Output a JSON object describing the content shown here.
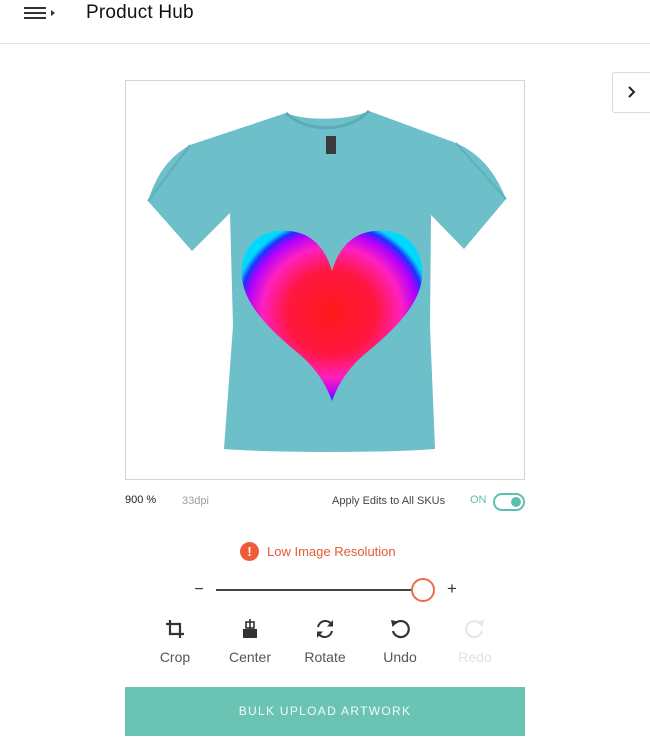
{
  "header": {
    "title": "Product Hub",
    "menu_icon": "menu-collapse-icon"
  },
  "side_toggle": {
    "icon": "chevron-right-icon"
  },
  "canvas": {
    "product": "t-shirt",
    "shirt_color": "#6dbfca",
    "artwork": "heart-gradient"
  },
  "status": {
    "zoom": "900 %",
    "dpi": "33dpi",
    "apply_label": "Apply Edits to All SKUs",
    "apply_state": "ON"
  },
  "warning": {
    "icon": "alert-icon",
    "text": "Low Image Resolution"
  },
  "zoom_slider": {
    "minus": "−",
    "plus": "+",
    "value": 1.0
  },
  "tools": [
    {
      "label": "Crop",
      "icon": "crop-icon",
      "enabled": true
    },
    {
      "label": "Center",
      "icon": "align-center-icon",
      "enabled": true
    },
    {
      "label": "Rotate",
      "icon": "rotate-icon",
      "enabled": true
    },
    {
      "label": "Undo",
      "icon": "undo-icon",
      "enabled": true
    },
    {
      "label": "Redo",
      "icon": "redo-icon",
      "enabled": false
    }
  ],
  "bulk_button": {
    "label": "BULK UPLOAD ARTWORK"
  },
  "colors": {
    "accent": "#6bc4b3",
    "warning": "#ee5a3a",
    "toggle": "#5bbfad"
  }
}
